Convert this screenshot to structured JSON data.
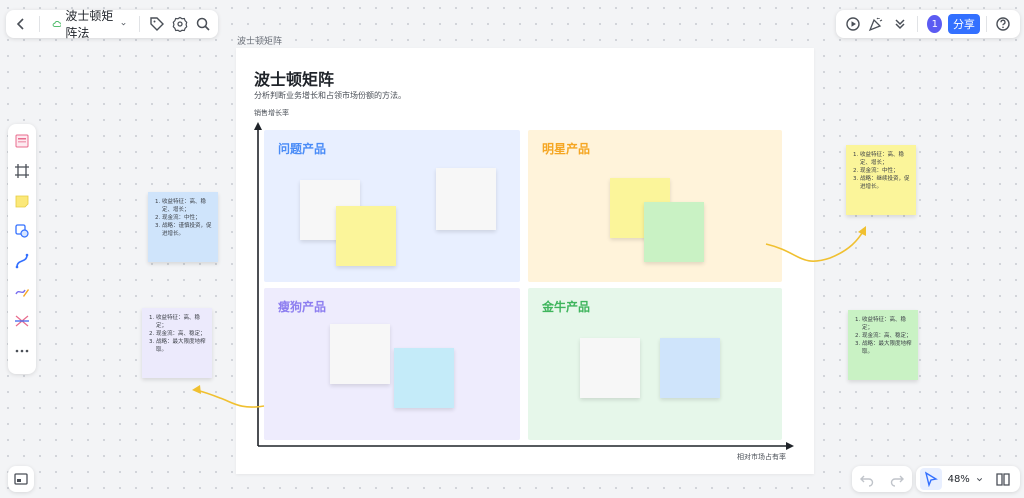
{
  "app": {
    "title": "波士顿矩阵法",
    "canvas_label": "波士顿矩阵",
    "user_badge": "1",
    "share_label": "分享",
    "zoom": "48%"
  },
  "icons": {
    "back": "chevron-left-icon",
    "cloud": "cloud-icon",
    "tag": "tag-icon",
    "settings": "gear-icon",
    "search": "search-icon",
    "present": "play-icon",
    "celebrate": "party-icon",
    "more": "double-chevron-down-icon",
    "help": "help-icon",
    "undo": "undo-icon",
    "redo": "redo-icon",
    "select": "cursor-icon",
    "map": "book-icon"
  },
  "frame": {
    "title": "波士顿矩阵",
    "subtitle": "分析判断业务增长和占领市场份额的方法。",
    "y_axis_label": "销售增长率",
    "x_axis_label": "相对市场占有率"
  },
  "quadrants": [
    {
      "label": "问题产品",
      "bg": "#e8efff",
      "color": "#4a8cf7"
    },
    {
      "label": "明星产品",
      "bg": "#fff3da",
      "color": "#f5a623"
    },
    {
      "label": "瘦狗产品",
      "bg": "#eeecfd",
      "color": "#8d7ef0"
    },
    {
      "label": "金牛产品",
      "bg": "#e6f7ea",
      "color": "#3fb55d"
    }
  ],
  "side_notes": {
    "left_top": [
      "收益特征：高、稳定、增长；",
      "现金流：中性；",
      "战略：谨慎投资，促进增长。"
    ],
    "left_bottom": [
      "收益特征：高、稳定；",
      "现金流：高、稳定；",
      "战略：最大限度地榨取。"
    ],
    "right_top": [
      "收益特征：高、稳定、增长；",
      "现金流：中性；",
      "战略：继续投资，促进增长。"
    ],
    "right_bottom": [
      "收益特征：高、稳定；",
      "现金流：高、稳定；",
      "战略：最大限度地榨取。"
    ]
  },
  "colors": {
    "accent": "#3370ff",
    "arrow": "#f0c030",
    "note_yellow": "#fbf59a",
    "note_green": "#c9f2c4",
    "note_blue": "#cfe4fb",
    "note_purple": "#eceafc",
    "note_cyan": "#c4ebf9",
    "note_white": "#f7f7f7"
  }
}
